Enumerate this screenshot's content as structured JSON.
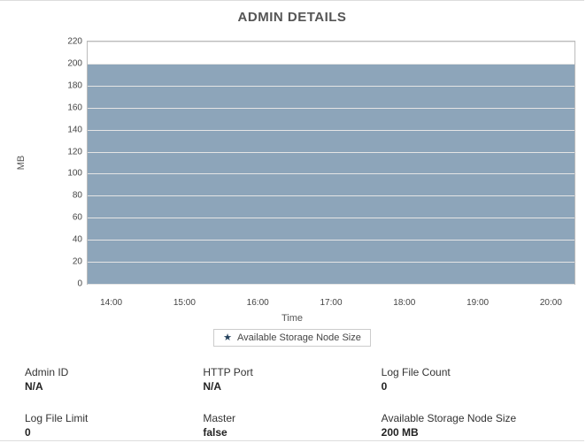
{
  "title": "ADMIN DETAILS",
  "chart_data": {
    "type": "area",
    "title": "ADMIN DETAILS",
    "xlabel": "Time",
    "ylabel": "MB",
    "ylim": [
      0,
      220
    ],
    "y_ticks": [
      0,
      20,
      40,
      60,
      80,
      100,
      120,
      140,
      160,
      180,
      200,
      220
    ],
    "x_ticks": [
      "14:00",
      "15:00",
      "16:00",
      "17:00",
      "18:00",
      "19:00",
      "20:00"
    ],
    "series": [
      {
        "name": "Available Storage Node Size",
        "color": "#8da5ba",
        "constant_value": 200
      }
    ],
    "legend": [
      "Available Storage Node Size"
    ]
  },
  "details": {
    "row1": {
      "c1": {
        "label": "Admin ID",
        "value": "N/A"
      },
      "c2": {
        "label": "HTTP Port",
        "value": "N/A"
      },
      "c3": {
        "label": "Log File Count",
        "value": "0"
      }
    },
    "row2": {
      "c1": {
        "label": "Log File Limit",
        "value": "0"
      },
      "c2": {
        "label": "Master",
        "value": "false"
      },
      "c3": {
        "label": "Available Storage Node Size",
        "value": "200 MB"
      }
    }
  }
}
